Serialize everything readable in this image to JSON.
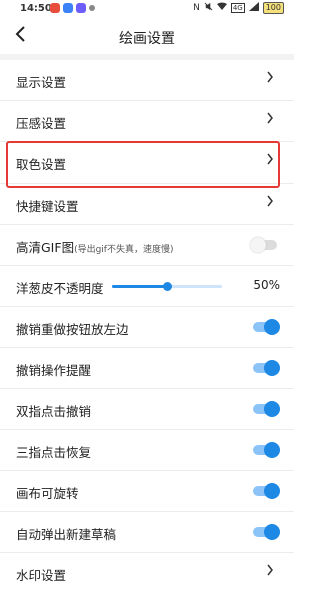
{
  "status_bar": {
    "time": "14:50",
    "right_icons": [
      "N",
      "mute",
      "wifi",
      "4G",
      "signal"
    ],
    "battery": "100",
    "app_colors": [
      "#e74c3c",
      "#3b82f6",
      "#6d5dfc",
      "#888888"
    ]
  },
  "header": {
    "back_icon": "chevron-left-icon",
    "title": "绘画设置"
  },
  "items": [
    {
      "label": "显示设置",
      "type": "nav"
    },
    {
      "label": "压感设置",
      "type": "nav"
    },
    {
      "label": "取色设置",
      "type": "nav",
      "highlighted": true
    },
    {
      "label": "快捷键设置",
      "type": "nav"
    },
    {
      "label": "高清GIF图",
      "sublabel": "(导出gif不失真，速度慢)",
      "type": "toggle",
      "on": false
    },
    {
      "label": "洋葱皮不透明度",
      "type": "slider",
      "value": 0.5,
      "value_text": "50%"
    },
    {
      "label": "撤销重做按钮放左边",
      "type": "toggle",
      "on": true
    },
    {
      "label": "撤销操作提醒",
      "type": "toggle",
      "on": true
    },
    {
      "label": "双指点击撤销",
      "type": "toggle",
      "on": true
    },
    {
      "label": "三指点击恢复",
      "type": "toggle",
      "on": true
    },
    {
      "label": "画布可旋转",
      "type": "toggle",
      "on": true
    },
    {
      "label": "自动弹出新建草稿",
      "type": "toggle",
      "on": true
    },
    {
      "label": "水印设置",
      "type": "nav"
    }
  ],
  "colors": {
    "accent": "#1e88e5",
    "highlight_border": "#e53935"
  }
}
